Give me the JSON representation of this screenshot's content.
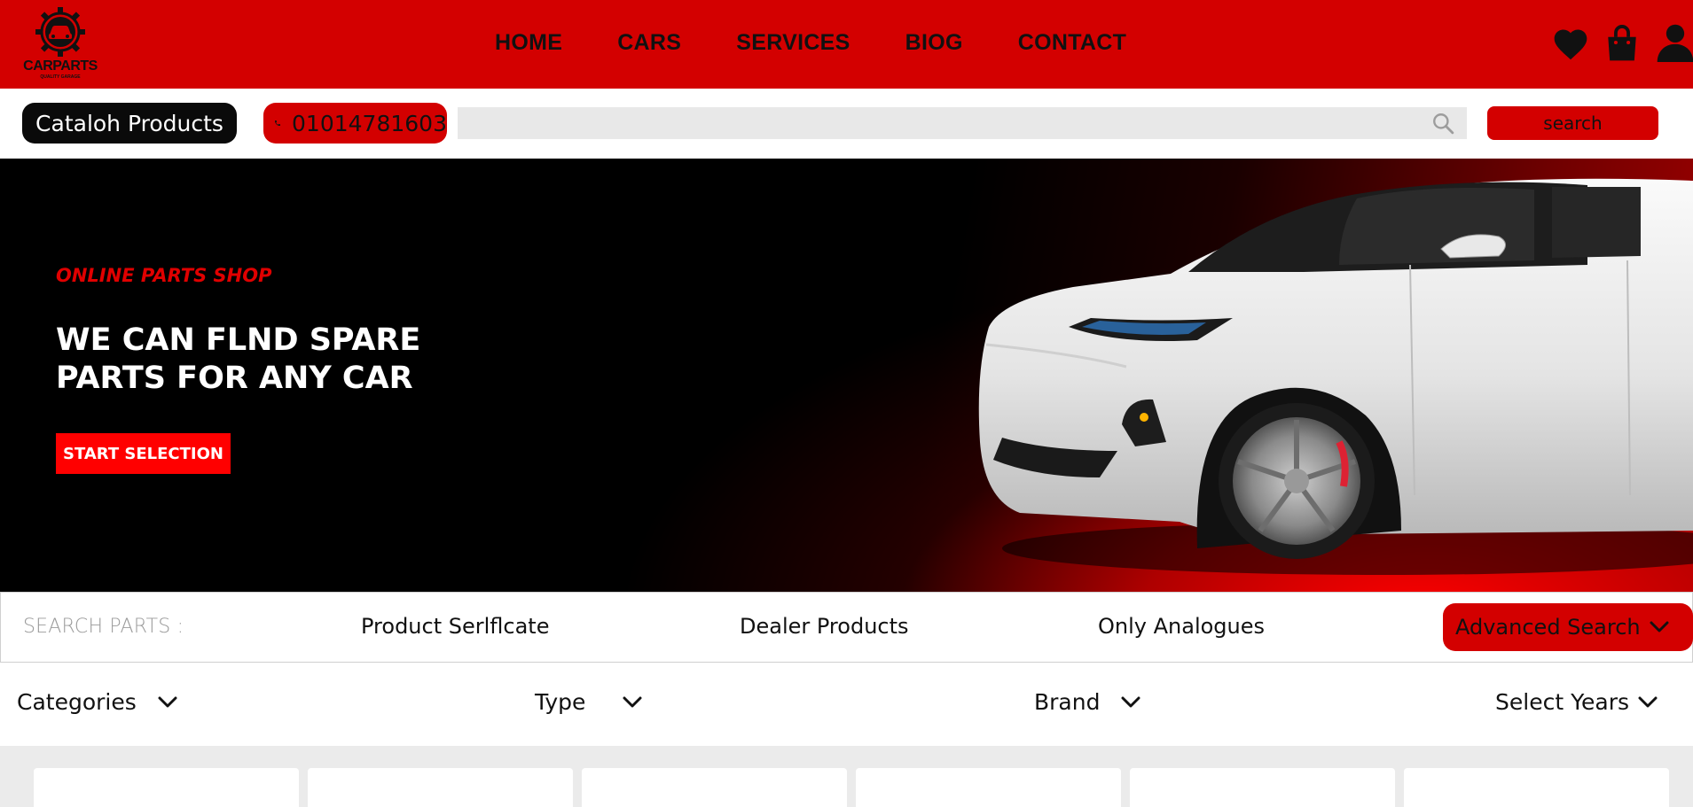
{
  "brand": {
    "name": "CARPARTS",
    "tagline": "QUALITY GARAGE",
    "primary_color": "#d30000",
    "dark_color": "#0a0a0a"
  },
  "nav": {
    "items": [
      {
        "label": "HOME"
      },
      {
        "label": "CARS"
      },
      {
        "label": "SERVICES"
      },
      {
        "label": "BIOG"
      },
      {
        "label": "CONTACT"
      }
    ],
    "icons": [
      "heart-icon",
      "shopping-bag-icon",
      "user-icon"
    ]
  },
  "search_bar": {
    "catalog_label": "Cataloh Products",
    "phone": "01014781603",
    "placeholder": "",
    "button_label": "search"
  },
  "hero": {
    "kicker": "ONLINE PARTS SHOP",
    "title_line1": "WE CAN FLND SPARE",
    "title_line2": "PARTS FOR ANY CAR",
    "cta_label": "START SELECTION"
  },
  "filter_tabs": {
    "label": "SEARCH PARTS :",
    "tabs": [
      {
        "label": "Product Serlflcate"
      },
      {
        "label": "Dealer Products"
      },
      {
        "label": "Only Analogues"
      }
    ],
    "advanced_label": "Advanced Search"
  },
  "dropdowns": [
    {
      "label": "Categories"
    },
    {
      "label": "Type"
    },
    {
      "label": "Brand"
    },
    {
      "label": "Select Years"
    }
  ],
  "product_cards_count": 6
}
